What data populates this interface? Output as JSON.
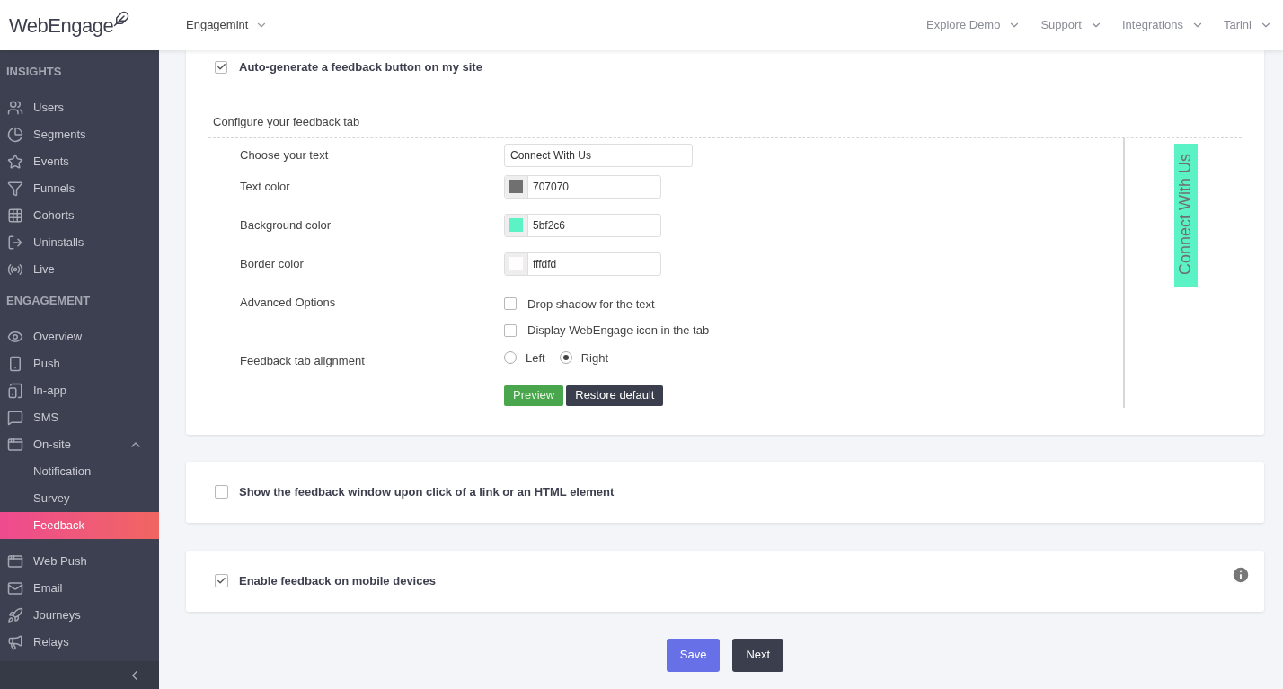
{
  "header": {
    "logo": "WebEngage",
    "project": "Engagemint",
    "nav": [
      "Explore Demo",
      "Support",
      "Integrations",
      "Tarini"
    ]
  },
  "sidebar": {
    "sections": [
      {
        "title": "INSIGHTS",
        "items": [
          {
            "label": "Users",
            "selected": false
          },
          {
            "label": "Segments",
            "selected": false
          },
          {
            "label": "Events",
            "selected": false
          },
          {
            "label": "Funnels",
            "selected": false
          },
          {
            "label": "Cohorts",
            "selected": false
          },
          {
            "label": "Uninstalls",
            "selected": false
          },
          {
            "label": "Live",
            "selected": false
          }
        ]
      },
      {
        "title": "ENGAGEMENT",
        "items": [
          {
            "label": "Overview",
            "selected": false
          },
          {
            "label": "Push",
            "selected": false
          },
          {
            "label": "In-app",
            "selected": false
          },
          {
            "label": "SMS",
            "selected": false
          },
          {
            "label": "On-site",
            "selected": false,
            "expanded": true,
            "children": [
              {
                "label": "Notification",
                "selected": false
              },
              {
                "label": "Survey",
                "selected": false
              },
              {
                "label": "Feedback",
                "selected": true
              }
            ]
          }
        ]
      },
      {
        "items": [
          {
            "label": "Web Push",
            "selected": false
          },
          {
            "label": "Email",
            "selected": false
          },
          {
            "label": "Journeys",
            "selected": false
          },
          {
            "label": "Relays",
            "selected": false
          }
        ]
      }
    ]
  },
  "auto_generate": {
    "label": "Auto-generate a feedback button on my site",
    "checked": true,
    "configure": {
      "title": "Configure your feedback tab",
      "rows": [
        {
          "kind": "text",
          "label": "Choose your text",
          "value": "Connect With Us"
        },
        {
          "kind": "color",
          "label": "Text color",
          "value": "707070",
          "color": "#707070"
        },
        {
          "kind": "color",
          "label": "Background color",
          "value": "5bf2c6",
          "color": "#5bf2c6"
        },
        {
          "kind": "color",
          "label": "Border color",
          "value": "fffdfd",
          "color": "#fffdfd"
        },
        {
          "kind": "checks",
          "label": "Advanced Options",
          "options": [
            {
              "label": "Drop shadow for the text",
              "checked": false
            },
            {
              "label": "Display WebEngage icon in the tab",
              "checked": false
            }
          ]
        },
        {
          "kind": "radio",
          "label": "Feedback tab alignment",
          "options": [
            {
              "label": "Left",
              "selected": false
            },
            {
              "label": "Right",
              "selected": true
            }
          ]
        },
        {
          "kind": "buttons",
          "buttons": [
            "Preview",
            "Restore default"
          ]
        }
      ],
      "preview": {
        "label": "Connect With Us"
      }
    }
  },
  "link_trigger": {
    "label": "Show the feedback window upon click of a link or an HTML element",
    "checked": false
  },
  "mobile": {
    "label": "Enable feedback on mobile devices",
    "checked": true
  },
  "actions": [
    "Save",
    "Next"
  ]
}
